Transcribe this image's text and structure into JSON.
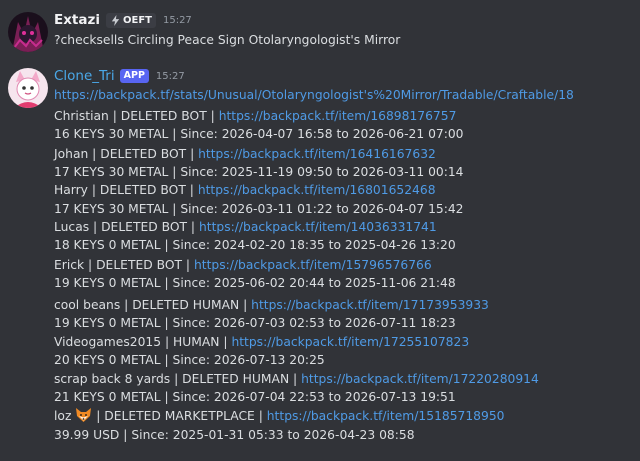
{
  "message1": {
    "author": "Extazi",
    "clan_tag": "OEFT",
    "timestamp": "15:27",
    "content": "?checksells Circling Peace Sign Otolaryngologist's Mirror"
  },
  "message2": {
    "author": "Clone_Tri",
    "app_tag": "APP",
    "timestamp": "15:27",
    "url": "https://backpack.tf/stats/Unusual/Otolaryngologist's%20Mirror/Tradable/Craftable/18",
    "entries": [
      {
        "head": "Christian | DELETED BOT | ",
        "link": "https://backpack.tf/item/16898176757",
        "detail": "16 KEYS 30 METAL | Since: 2026-04-07 16:58 to 2026-06-21 07:00"
      },
      {
        "head": "Johan | DELETED BOT | ",
        "link": "https://backpack.tf/item/16416167632",
        "detail": "17 KEYS 30 METAL | Since: 2025-11-19 09:50 to 2026-03-11 00:14"
      },
      {
        "head": "Harry | DELETED BOT | ",
        "link": "https://backpack.tf/item/16801652468",
        "detail": "17 KEYS 30 METAL | Since: 2026-03-11 01:22 to 2026-04-07 15:42"
      },
      {
        "head": "Lucas | DELETED BOT | ",
        "link": "https://backpack.tf/item/14036331741",
        "detail": "18 KEYS 0 METAL | Since: 2024-02-20 18:35 to 2025-04-26 13:20"
      },
      {
        "head": "Erick | DELETED BOT | ",
        "link": "https://backpack.tf/item/15796576766",
        "detail": "19 KEYS 0 METAL | Since: 2025-06-02 20:44 to 2025-11-06 21:48"
      },
      {
        "head": "cool beans | DELETED HUMAN | ",
        "link": "https://backpack.tf/item/17173953933",
        "detail": "19 KEYS 0 METAL | Since: 2026-07-03 02:53 to 2026-07-11 18:23"
      },
      {
        "head": "Videogames2015 | HUMAN | ",
        "link": "https://backpack.tf/item/17255107823",
        "detail": "20 KEYS 0 METAL | Since: 2026-07-13 20:25"
      },
      {
        "head": "scrap back 8 yards | DELETED HUMAN | ",
        "link": "https://backpack.tf/item/17220280914",
        "detail": "21 KEYS 0 METAL | Since: 2026-07-04 22:53 to 2026-07-13 19:51"
      },
      {
        "head": "loz ",
        "emoji": "fox-face-emoji",
        "head2": " | DELETED MARKETPLACE | ",
        "link": "https://backpack.tf/item/15185718950",
        "detail": "39.99 USD | Since: 2025-01-31 05:33 to 2026-04-23 08:58"
      }
    ]
  }
}
